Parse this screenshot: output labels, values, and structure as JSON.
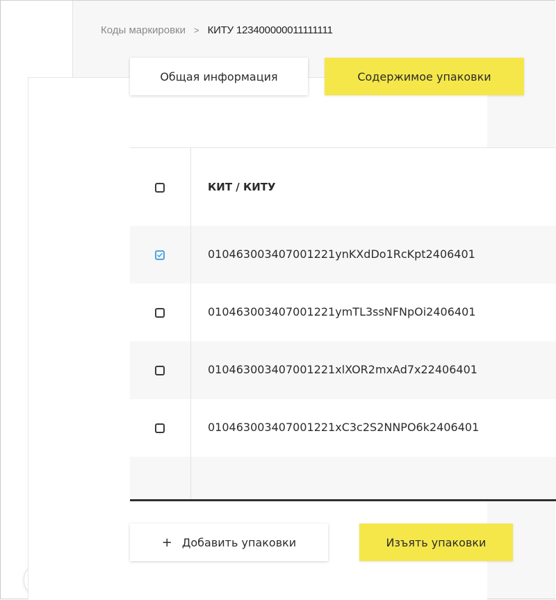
{
  "breadcrumb": {
    "parent": "Коды маркировки",
    "separator": ">",
    "current": "КИТУ 123400000011111111"
  },
  "tabs": [
    {
      "label": "Общая информация",
      "active": false
    },
    {
      "label": "Содержимое упаковки",
      "active": true
    }
  ],
  "table": {
    "header": "КИТ / КИТУ",
    "rows": [
      {
        "code": "010463003407001221ynKXdDo1RcKpt2406401",
        "checked": true
      },
      {
        "code": "010463003407001221ymTL3ssNFNpOi2406401",
        "checked": false
      },
      {
        "code": "010463003407001221xlXOR2mxAd7x22406401",
        "checked": false
      },
      {
        "code": "010463003407001221xC3c2S2NNPO6k2406401",
        "checked": false
      }
    ]
  },
  "actions": {
    "add_icon": "+",
    "add_label": "Добавить упаковки",
    "withdraw_label": "Изъять упаковки"
  },
  "sidebar": {
    "icons": [
      "scan-frame-icon",
      "package-box-icon",
      "pie-chart-icon",
      "transfer-arrows-icon",
      "checklist-icon"
    ],
    "menu_icon": "hamburger-menu-icon"
  },
  "colors": {
    "accent": "#f5e74a",
    "checkbox_checked": "#4aa3df",
    "table_bottom_border": "#2f2f2f"
  }
}
